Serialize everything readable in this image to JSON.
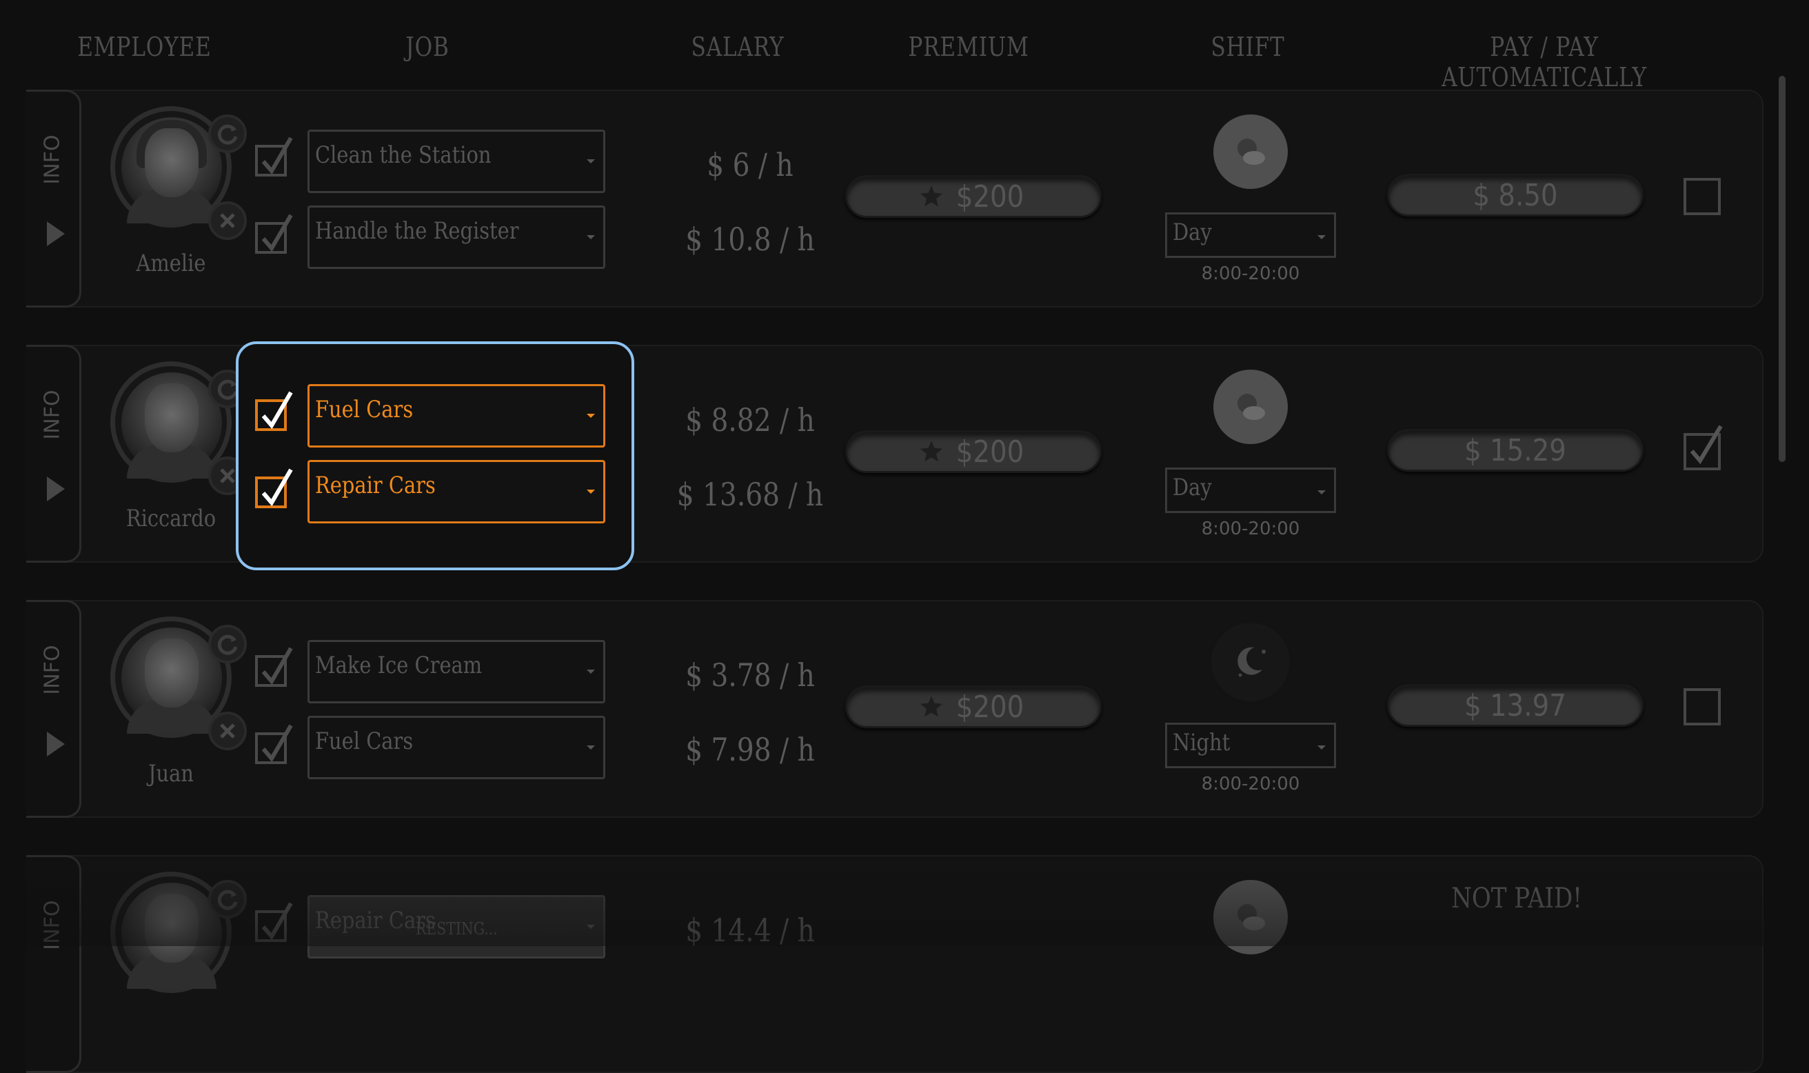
{
  "headers": {
    "employee": "EMPLOYEE",
    "job": "JOB",
    "salary": "SALARY",
    "premium": "PREMIUM",
    "shift": "SHIFT",
    "pay": "PAY / PAY AUTOMATICALLY"
  },
  "info_label": "INFO",
  "employees": [
    {
      "name": "Amelie",
      "jobs": [
        {
          "label": "Clean the Station",
          "checked": true
        },
        {
          "label": "Handle the Register",
          "checked": true
        }
      ],
      "salaries": [
        "$ 6 / h",
        "$ 10.8 / h"
      ],
      "premium": "$200",
      "shift": "Day",
      "shift_icon": "day-cloud-icon",
      "hours": "8:00-20:00",
      "pay": "$ 8.50",
      "pay_automatically": false
    },
    {
      "name": "Riccardo",
      "jobs": [
        {
          "label": "Fuel Cars",
          "checked": true
        },
        {
          "label": "Repair Cars",
          "checked": true
        }
      ],
      "salaries": [
        "$ 8.82 / h",
        "$ 13.68 / h"
      ],
      "premium": "$200",
      "shift": "Day",
      "shift_icon": "day-cloud-icon",
      "hours": "8:00-20:00",
      "pay": "$ 15.29",
      "pay_automatically": true
    },
    {
      "name": "Juan",
      "jobs": [
        {
          "label": "Make Ice Cream",
          "checked": true
        },
        {
          "label": "Fuel Cars",
          "checked": true
        }
      ],
      "salaries": [
        "$ 3.78 / h",
        "$ 7.98 / h"
      ],
      "premium": "$200",
      "shift": "Night",
      "shift_icon": "moon-stars-icon",
      "hours": "8:00-20:00",
      "pay": "$ 13.97",
      "pay_automatically": false
    },
    {
      "name": "",
      "jobs": [
        {
          "label": "Repair Cars",
          "checked": true,
          "status": "RESTING..."
        }
      ],
      "salaries": [
        "$ 14.4 / h"
      ],
      "shift_icon": "day-cloud-icon",
      "pay_status": "NOT PAID!"
    }
  ],
  "colors": {
    "accent_orange": "#f08a1c",
    "highlight_blue": "#8dc2f0",
    "background": "#0f0f0f"
  }
}
